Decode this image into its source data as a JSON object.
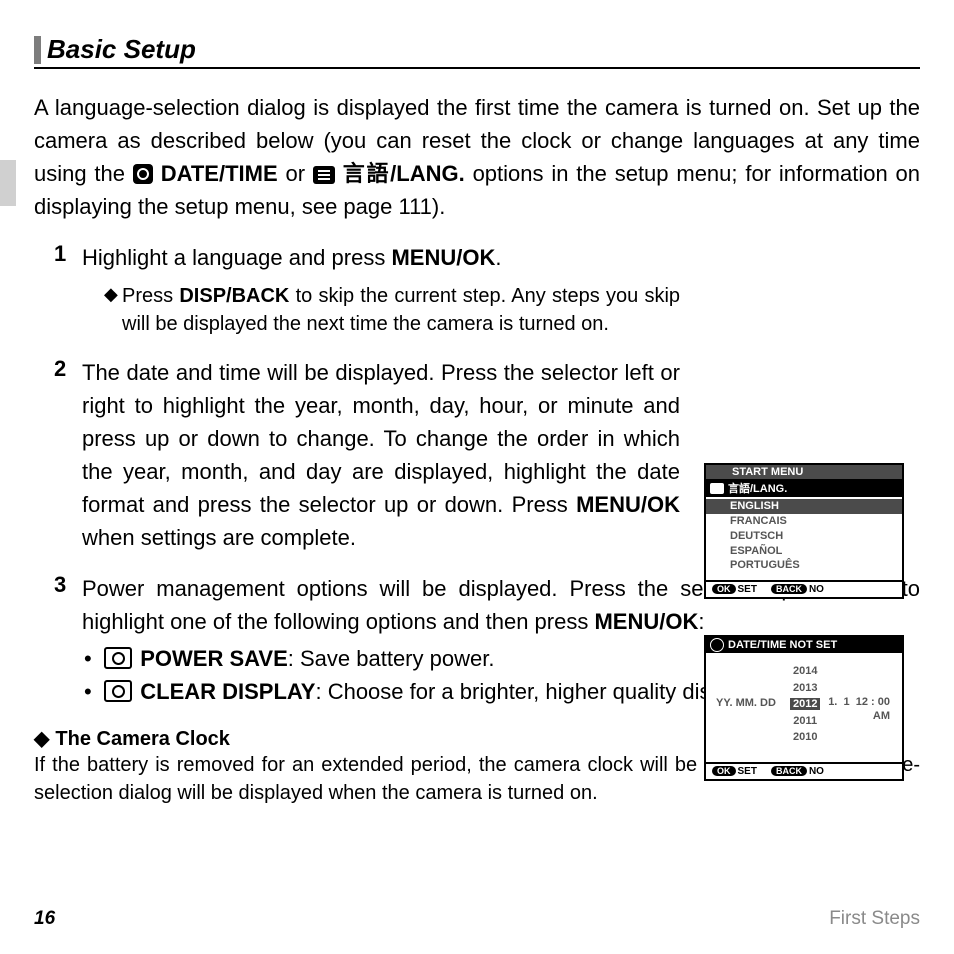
{
  "heading": "Basic Setup",
  "intro_p1": "A language-selection dialog is displayed the first time the camera is turned on. Set up the camera as described below (you can reset the clock or change languages at any time using the ",
  "intro_datetime": "DATE/TIME",
  "intro_or": " or ",
  "intro_lang_jp": "言語/LANG.",
  "intro_p2": " options in the setup menu; for information on displaying the setup menu, see page 111).",
  "step1_num": "1",
  "step1_text_a": "Highlight a language and press ",
  "step1_menuok": "MENU/OK",
  "step1_text_b": ".",
  "step1_note_a": "Press ",
  "step1_dispback": "DISP/BACK",
  "step1_note_b": " to skip the current step. Any steps you skip will be displayed the next time the camera is turned on.",
  "step2_num": "2",
  "step2_text_a": "The date and time will be displayed. Press the selector left or right to highlight the year, month, day, hour, or minute and press up or down to change. To change the order in which the year, month, and day are displayed, highlight the date format and press the selector up or down. Press ",
  "step2_menuok": "MENU/OK",
  "step2_text_b": " when settings are complete.",
  "step3_num": "3",
  "step3_text_a": "Power management options will be displayed. Press the selector up or down to highlight one of the following options and then press ",
  "step3_menuok": "MENU/OK",
  "step3_text_b": ":",
  "bullet1_label": "POWER SAVE",
  "bullet1_rest": ": Save battery power.",
  "bullet2_label": "CLEAR DISPLAY",
  "bullet2_rest": ": Choose for a brighter, higher quality display.",
  "note_head": "The Camera Clock",
  "note_body": "If the battery is removed for an extended period, the camera clock will be reset and the language-selection dialog will be displayed when the camera is turned on.",
  "footer": {
    "page": "16",
    "chapter": "First Steps"
  },
  "lcd1": {
    "start": "START MENU",
    "lang": "言語/LANG.",
    "options": [
      "ENGLISH",
      "FRANCAIS",
      "DEUTSCH",
      "ESPAÑOL",
      "PORTUGUÊS"
    ],
    "ok": "OK",
    "set": "SET",
    "back": "BACK",
    "no": "NO"
  },
  "lcd2": {
    "title": "DATE/TIME NOT SET",
    "fmt": "YY. MM. DD",
    "years": [
      "2014",
      "2013",
      "2012",
      "2011",
      "2010"
    ],
    "month": "1.",
    "day": "1",
    "time": "12 : 00",
    "ampm": "AM",
    "ok": "OK",
    "set": "SET",
    "back": "BACK",
    "no": "NO"
  }
}
